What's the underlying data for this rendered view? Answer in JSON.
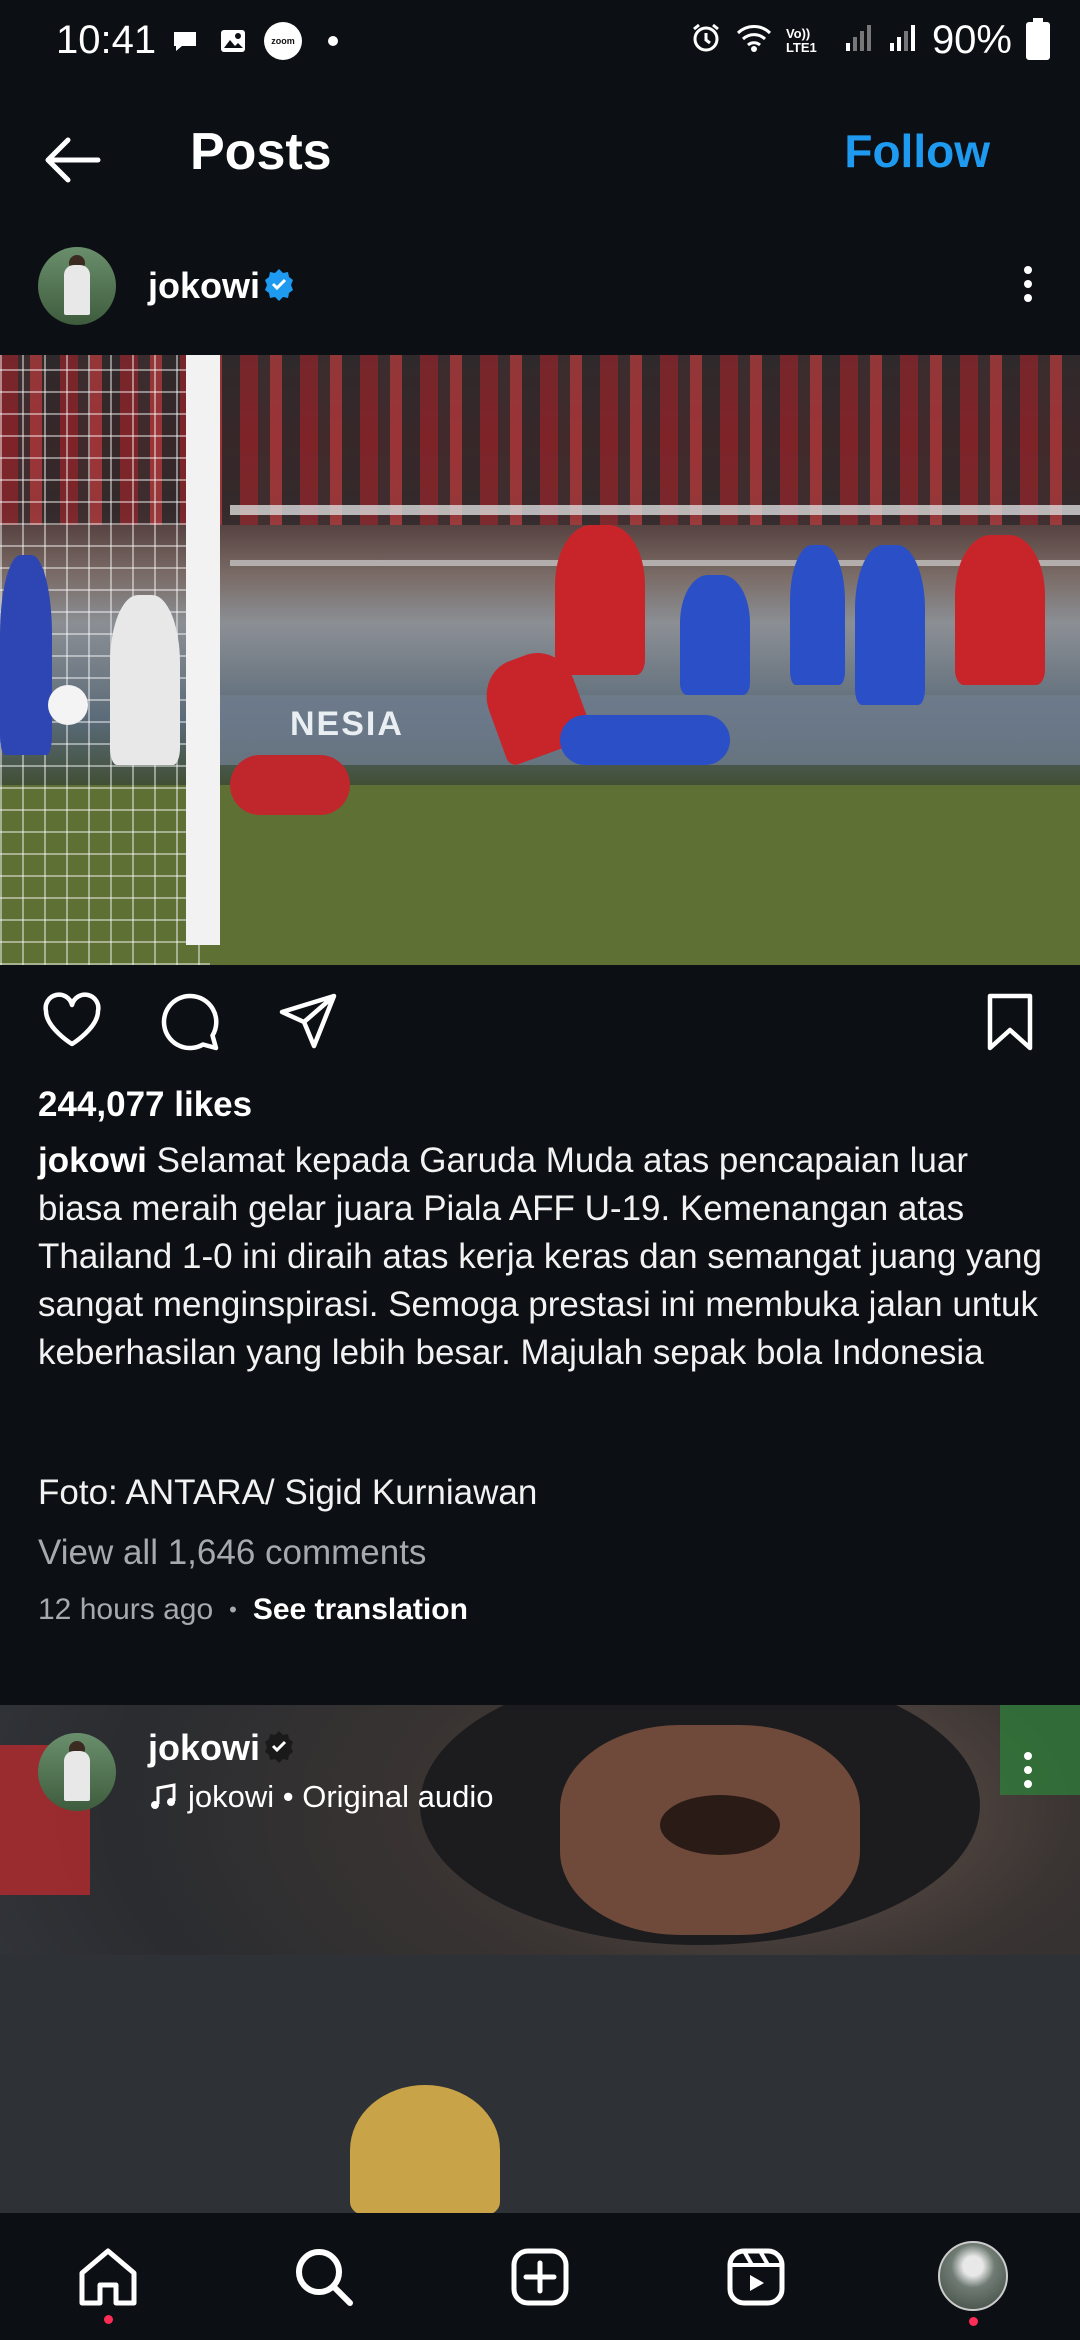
{
  "status_bar": {
    "time": "10:41",
    "battery": "90%",
    "left_icons": [
      "chat-icon",
      "gallery-icon",
      "zoom-icon",
      "dot-icon"
    ],
    "zoom_label": "zoom",
    "network_label": "Vo)) LTE1",
    "right_icons": [
      "alarm-icon",
      "wifi-icon",
      "signal-icon",
      "signal-icon",
      "battery-icon"
    ]
  },
  "header": {
    "title": "Posts",
    "follow_label": "Follow",
    "back_icon": "arrow-left-icon"
  },
  "post1": {
    "username": "jokowi",
    "verified": true,
    "photo_board_text": "NESIA",
    "likes": "244,077 likes",
    "caption_user": "jokowi",
    "caption_text": "Selamat kepada Garuda Muda atas pencapaian luar biasa meraih gelar juara Piala AFF U-19. Kemenangan atas Thailand 1-0 ini diraih atas kerja keras dan semangat juang yang sangat menginspirasi. Semoga prestasi ini membuka jalan untuk keberhasilan yang lebih besar. Majulah sepak bola Indonesia",
    "credit": "Foto: ANTARA/ Sigid Kurniawan",
    "view_comments": "View all 1,646 comments",
    "time_ago": "12 hours ago",
    "see_translation": "See translation",
    "actions": [
      "heart-icon",
      "comment-icon",
      "share-icon",
      "bookmark-icon"
    ]
  },
  "post2": {
    "username": "jokowi",
    "audio_text": "jokowi • Original audio"
  },
  "bottom_nav": [
    "home-icon",
    "search-icon",
    "add-icon",
    "reels-icon",
    "profile-avatar"
  ],
  "colors": {
    "background": "#0c0f14",
    "accent": "#1e9bf0",
    "notification_dot": "#ff2d55"
  }
}
